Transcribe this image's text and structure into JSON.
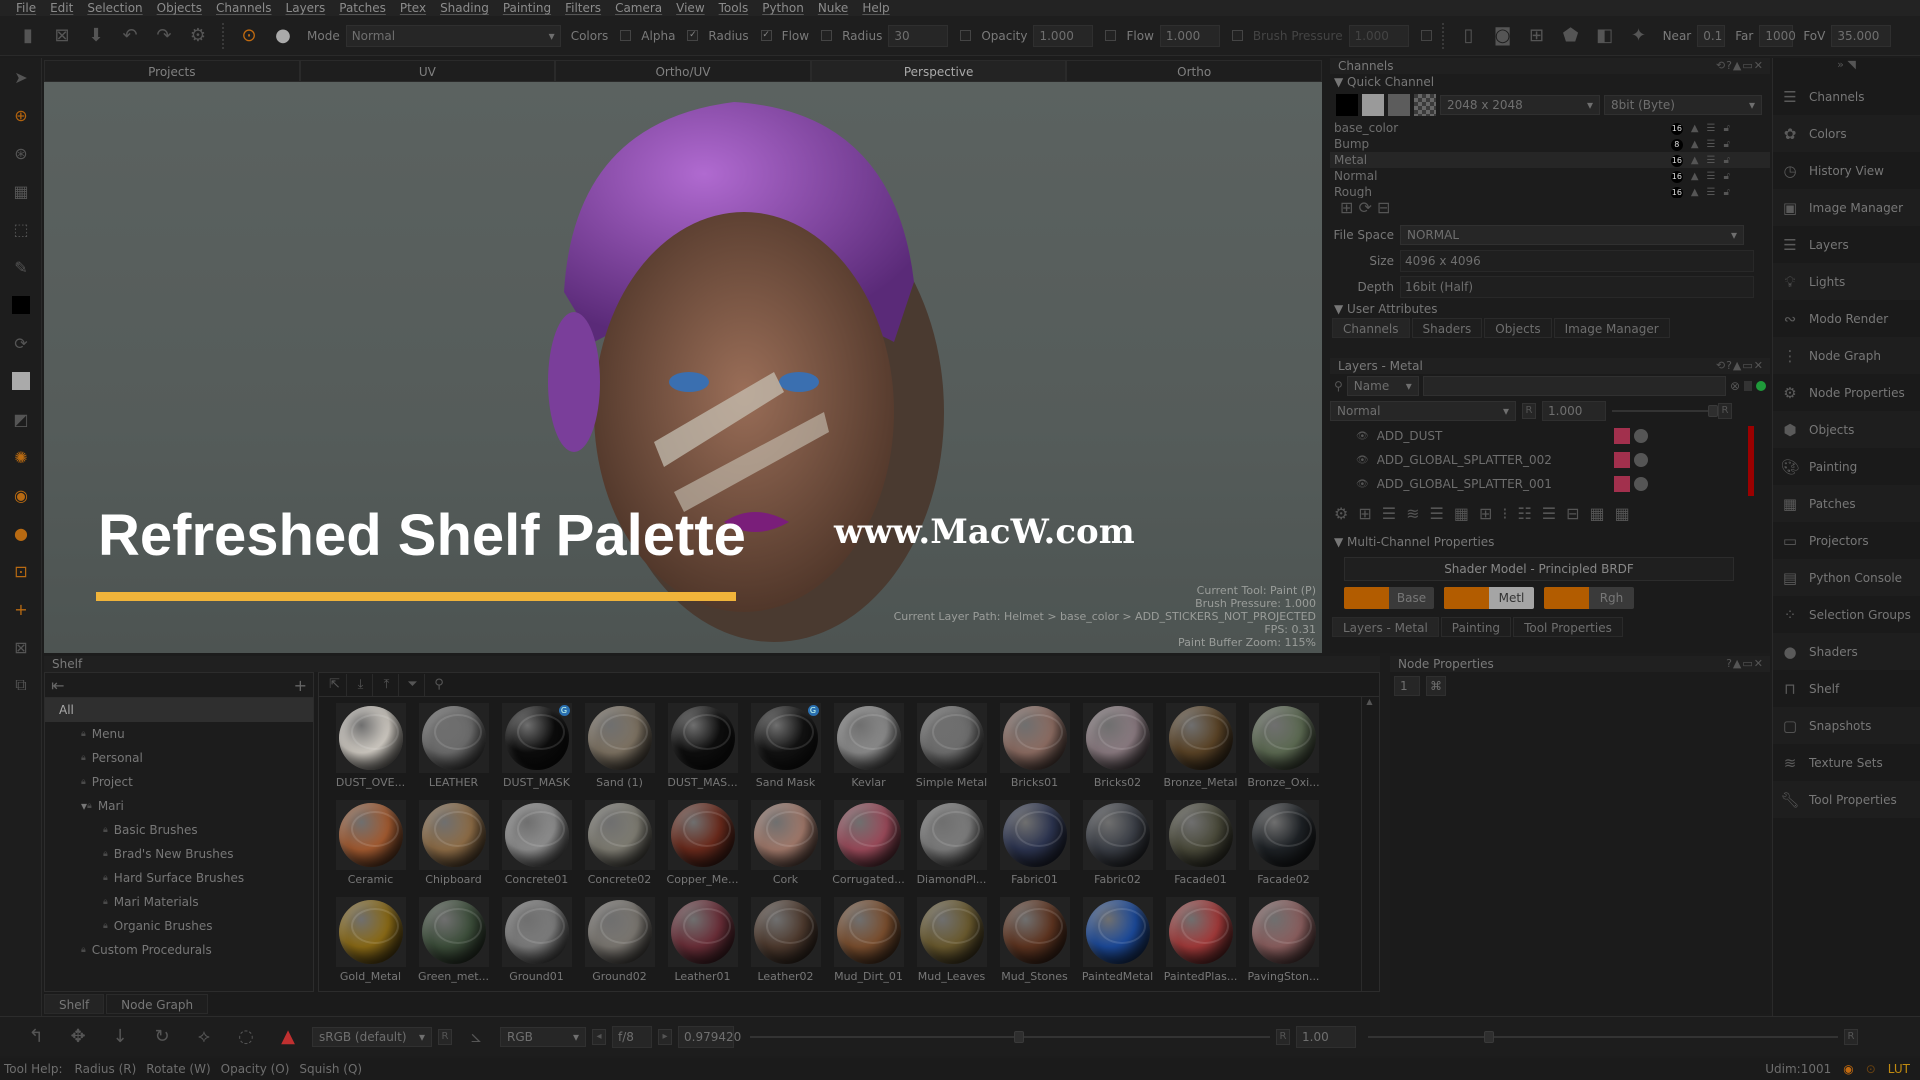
{
  "menubar": [
    "File",
    "Edit",
    "Selection",
    "Objects",
    "Channels",
    "Layers",
    "Patches",
    "Ptex",
    "Shading",
    "Painting",
    "Filters",
    "Camera",
    "View",
    "Tools",
    "Python",
    "Nuke",
    "Help"
  ],
  "toolbar": {
    "mode_label": "Mode",
    "mode_value": "Normal",
    "colors_label": "Colors",
    "alpha_label": "Alpha",
    "alpha_checked": false,
    "radius_check_label": "Radius",
    "radius_checked": true,
    "flow_check_label": "Flow",
    "flow_checked": true,
    "radius_label": "Radius",
    "radius_value": "30",
    "opacity_label": "Opacity",
    "opacity_value": "1.000",
    "flow_label": "Flow",
    "flow_value": "1.000",
    "brush_pressure_label": "Brush Pressure",
    "brush_pressure_value": "1.000",
    "near_label": "Near",
    "near_value": "0.1",
    "far_label": "Far",
    "far_value": "1000",
    "fov_label": "FoV",
    "fov_value": "35.000"
  },
  "view_tabs": [
    "Projects",
    "UV",
    "Ortho/UV",
    "Perspective",
    "Ortho"
  ],
  "active_view_tab": "Perspective",
  "viewport": {
    "overlay_title": "Refreshed Shelf Palette",
    "overlay_bar_color": "#f1b43a",
    "watermark": "www.MacW.com",
    "info": [
      "Current Tool: Paint (P)",
      "Brush Pressure: 1.000",
      "Current Layer Path: Helmet > base_color > ADD_STICKERS_NOT_PROJECTED",
      "FPS: 0.31",
      "Paint Buffer Zoom: 115%"
    ]
  },
  "channels_panel": {
    "title": "Channels",
    "quick_channel_label": "Quick Channel",
    "resolution": "2048 x 2048",
    "depth": "8bit  (Byte)",
    "channels": [
      {
        "name": "base_color",
        "bits": "16"
      },
      {
        "name": "Bump",
        "bits": "8"
      },
      {
        "name": "Metal",
        "bits": "16",
        "selected": true
      },
      {
        "name": "Normal",
        "bits": "16"
      },
      {
        "name": "Rough",
        "bits": "16"
      }
    ]
  },
  "channel_props": {
    "file_space_label": "File Space",
    "file_space_value": "NORMAL",
    "size_label": "Size",
    "size_value": "4096 x 4096",
    "depth_label": "Depth",
    "depth_value": "16bit (Half)",
    "user_attributes_label": "User Attributes",
    "tabs": [
      "Channels",
      "Shaders",
      "Objects",
      "Image Manager"
    ]
  },
  "layers_panel": {
    "title": "Layers - Metal",
    "filter_dropdown": "Name",
    "blend_mode": "Normal",
    "opacity": "1.000",
    "layers": [
      "ADD_DUST",
      "ADD_GLOBAL_SPLATTER_002",
      "ADD_GLOBAL_SPLATTER_001"
    ],
    "layer_color": "#a2304d"
  },
  "multichannel": {
    "title": "Multi-Channel Properties",
    "shader_model": "Shader Model - Principled BRDF",
    "buttons": [
      {
        "label": "Base",
        "active": false
      },
      {
        "label": "Metl",
        "active": true
      },
      {
        "label": "Rgh",
        "active": false
      }
    ],
    "bottom_tabs": [
      "Layers - Metal",
      "Painting",
      "Tool Properties"
    ]
  },
  "node_properties": {
    "title": "Node Properties",
    "value": "1"
  },
  "shelf": {
    "title": "Shelf",
    "tree": [
      {
        "label": "All",
        "level": 0,
        "selected": true
      },
      {
        "label": "Menu",
        "level": 1
      },
      {
        "label": "Personal",
        "level": 1
      },
      {
        "label": "Project",
        "level": 1
      },
      {
        "label": "Mari",
        "level": 1,
        "expanded": true
      },
      {
        "label": "Basic Brushes",
        "level": 2
      },
      {
        "label": "Brad's New Brushes",
        "level": 2
      },
      {
        "label": "Hard Surface Brushes",
        "level": 2
      },
      {
        "label": "Mari Materials",
        "level": 2
      },
      {
        "label": "Organic Brushes",
        "level": 2
      },
      {
        "label": "Custom Procedurals",
        "level": 1
      }
    ],
    "materials": [
      {
        "name": "DUST_OVE...",
        "color": "#cfcac2"
      },
      {
        "name": "LEATHER",
        "color": "#6c6c6c"
      },
      {
        "name": "DUST_MASK",
        "color": "#0c0c0c",
        "badge": "G"
      },
      {
        "name": "Sand (1)",
        "color": "#7d7262"
      },
      {
        "name": "DUST_MAS...",
        "color": "#0e0e0e"
      },
      {
        "name": "Sand Mask",
        "color": "#121212",
        "badge": "G"
      },
      {
        "name": "Kevlar",
        "color": "#8a8a8a"
      },
      {
        "name": "Simple Metal",
        "color": "#6e6e6e"
      },
      {
        "name": "Bricks01",
        "color": "#8c6c62"
      },
      {
        "name": "Bricks02",
        "color": "#8a7a80"
      },
      {
        "name": "Bronze_Metal",
        "color": "#5a4326"
      },
      {
        "name": "Bronze_Oxi...",
        "color": "#5c6a52"
      },
      {
        "name": "Ceramic",
        "color": "#a25a30"
      },
      {
        "name": "Chipboard",
        "color": "#8d6c46"
      },
      {
        "name": "Concrete01",
        "color": "#8e8e8e"
      },
      {
        "name": "Concrete02",
        "color": "#7e7c72"
      },
      {
        "name": "Copper_Me...",
        "color": "#6a2a1c"
      },
      {
        "name": "Cork",
        "color": "#a0786a"
      },
      {
        "name": "Corrugated...",
        "color": "#9a4a5a"
      },
      {
        "name": "DiamondPl...",
        "color": "#7c7c7c"
      },
      {
        "name": "Fabric01",
        "color": "#2c3450"
      },
      {
        "name": "Fabric02",
        "color": "#3a3e46"
      },
      {
        "name": "Facade01",
        "color": "#4a4a3a"
      },
      {
        "name": "Facade02",
        "color": "#1e2226"
      },
      {
        "name": "Gold_Metal",
        "color": "#8a6a16"
      },
      {
        "name": "Green_met...",
        "color": "#3c4e3a"
      },
      {
        "name": "Ground01",
        "color": "#7c7c7c"
      },
      {
        "name": "Ground02",
        "color": "#7a7670"
      },
      {
        "name": "Leather01",
        "color": "#6a2e38"
      },
      {
        "name": "Leather02",
        "color": "#4e3a2e"
      },
      {
        "name": "Mud_Dirt_01",
        "color": "#7a4e2e"
      },
      {
        "name": "Mud_Leaves",
        "color": "#6a5a2e"
      },
      {
        "name": "Mud_Stones",
        "color": "#5e3420"
      },
      {
        "name": "PaintedMetal",
        "color": "#1c4a9a"
      },
      {
        "name": "PaintedPlas...",
        "color": "#a23a3a"
      },
      {
        "name": "PavingSton...",
        "color": "#8a5e5e"
      }
    ],
    "bottom_tabs": [
      "Shelf",
      "Node Graph"
    ]
  },
  "right_dock": [
    "Channels",
    "Colors",
    "History View",
    "Image Manager",
    "Layers",
    "Lights",
    "Modo Render",
    "Node Graph",
    "Node Properties",
    "Objects",
    "Painting",
    "Patches",
    "Projectors",
    "Python Console",
    "Selection Groups",
    "Shaders",
    "Shelf",
    "Snapshots",
    "Texture Sets",
    "Tool Properties"
  ],
  "bottom_toolbar": {
    "colorspace": "sRGB (default)",
    "channel_mode": "RGB",
    "fstop": "f/8",
    "exposure": "0.979420",
    "gain": "1.00",
    "reset_label": "R"
  },
  "statusbar": {
    "tool_help_label": "Tool Help:",
    "hints": [
      "Radius (R)",
      "Rotate (W)",
      "Opacity (O)",
      "Squish (Q)"
    ],
    "udim": "Udim:1001"
  }
}
